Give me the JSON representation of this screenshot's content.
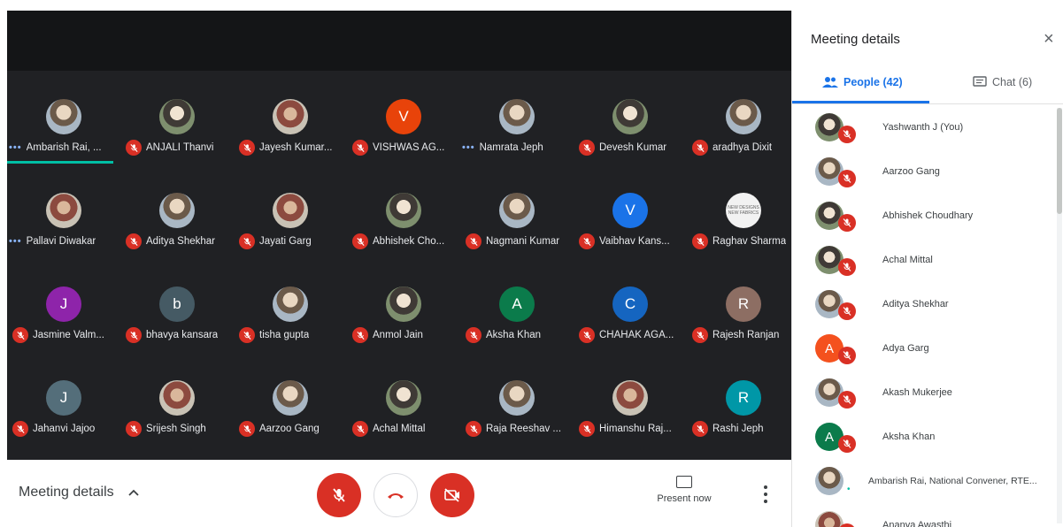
{
  "colors": {
    "accent": "#1a73e8",
    "muted_red": "#d93025",
    "speaking_green": "#00bfa5",
    "tile_bg": "#202124"
  },
  "participants_grid": [
    {
      "name": "Ambarish Rai, ...",
      "avatar": "photo",
      "speaking": true
    },
    {
      "name": "ANJALI Thanvi",
      "avatar": "photo2"
    },
    {
      "name": "Jayesh Kumar...",
      "avatar": "photo3"
    },
    {
      "name": "VISHWAS AG...",
      "avatar": "letter",
      "letter": "V",
      "color": "#e8430a"
    },
    {
      "name": "Namrata Jeph",
      "avatar": "photo",
      "speaking": true
    },
    {
      "name": "Devesh Kumar",
      "avatar": "photo2"
    },
    {
      "name": "aradhya Dixit",
      "avatar": "photo"
    },
    {
      "name": "Pallavi Diwakar",
      "avatar": "photo3",
      "speaking": true
    },
    {
      "name": "Aditya Shekhar",
      "avatar": "photo"
    },
    {
      "name": "Jayati Garg",
      "avatar": "photo3"
    },
    {
      "name": "Abhishek Cho...",
      "avatar": "photo2"
    },
    {
      "name": "Nagmani Kumar",
      "avatar": "photo"
    },
    {
      "name": "Vaibhav Kans...",
      "avatar": "letter",
      "letter": "V",
      "color": "#1a73e8"
    },
    {
      "name": "Raghav Sharma",
      "avatar": "logo",
      "logo_text": "NEW DESIGNS NEW FABRICS"
    },
    {
      "name": "Jasmine Valm...",
      "avatar": "letter",
      "letter": "J",
      "color": "#8e24aa"
    },
    {
      "name": "bhavya kansara",
      "avatar": "letter",
      "letter": "b",
      "color": "#455a64"
    },
    {
      "name": "tisha gupta",
      "avatar": "photo"
    },
    {
      "name": "Anmol Jain",
      "avatar": "photo2"
    },
    {
      "name": "Aksha Khan",
      "avatar": "letter",
      "letter": "A",
      "color": "#0b7b4b"
    },
    {
      "name": "CHAHAK AGA...",
      "avatar": "letter",
      "letter": "C",
      "color": "#1565c0"
    },
    {
      "name": "Rajesh Ranjan",
      "avatar": "letter",
      "letter": "R",
      "color": "#8d6e63"
    },
    {
      "name": "Jahanvi Jajoo",
      "avatar": "letter",
      "letter": "J",
      "color": "#546e7a"
    },
    {
      "name": "Srijesh Singh",
      "avatar": "photo3"
    },
    {
      "name": "Aarzoo Gang",
      "avatar": "photo"
    },
    {
      "name": "Achal Mittal",
      "avatar": "photo2"
    },
    {
      "name": "Raja Reeshav ...",
      "avatar": "photo"
    },
    {
      "name": "Himanshu Raj...",
      "avatar": "photo3"
    },
    {
      "name": "Rashi Jeph",
      "avatar": "letter",
      "letter": "R",
      "color": "#0097a7"
    }
  ],
  "bottom_bar": {
    "meeting_details_label": "Meeting details",
    "present_label": "Present now"
  },
  "panel": {
    "title": "Meeting details",
    "close": "×",
    "tab_people": "People (42)",
    "tab_chat": "Chat (6)",
    "people": [
      {
        "name": "Yashwanth J (You)",
        "avatar": "photo2",
        "muted": true
      },
      {
        "name": "Aarzoo Gang",
        "avatar": "photo",
        "muted": true
      },
      {
        "name": "Abhishek Choudhary",
        "avatar": "photo2",
        "muted": true
      },
      {
        "name": "Achal Mittal",
        "avatar": "photo2",
        "muted": true
      },
      {
        "name": "Aditya Shekhar",
        "avatar": "photo",
        "muted": true
      },
      {
        "name": "Adya Garg",
        "avatar": "letter",
        "letter": "A",
        "color": "#f4511e",
        "muted": true
      },
      {
        "name": "Akash Mukerjee",
        "avatar": "photo",
        "muted": true
      },
      {
        "name": "Aksha Khan",
        "avatar": "letter",
        "letter": "A",
        "color": "#0b7b4b",
        "muted": true
      },
      {
        "name": "Ambarish Rai, National Convener, RTE...",
        "avatar": "photo",
        "muted": false,
        "speaking": true
      },
      {
        "name": "Ananya Awasthi",
        "avatar": "photo3",
        "muted": true
      }
    ]
  }
}
